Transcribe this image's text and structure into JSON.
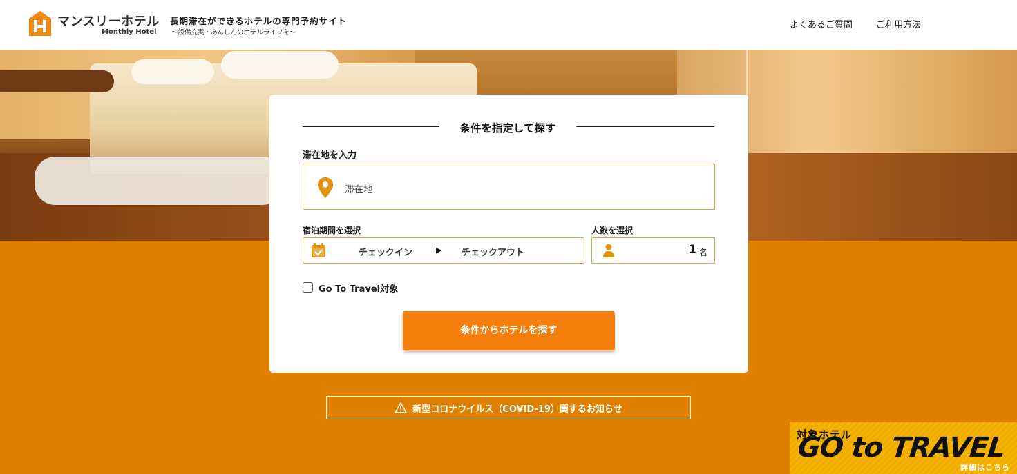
{
  "header": {
    "logo_name": "マンスリーホテル",
    "logo_sub": "Monthly Hotel",
    "tagline": "長期滞在ができるホテルの専門予約サイト",
    "tagline_sub": "〜設備充実・あんしんのホテルライフを〜",
    "nav": {
      "faq": "よくあるご質問",
      "howto": "ご利用方法"
    }
  },
  "search": {
    "title": "条件を指定して探す",
    "area_label": "滞在地を入力",
    "area_placeholder": "滞在地",
    "date_label": "宿泊期間を選択",
    "checkin": "チェックイン",
    "arrow": "▶",
    "checkout": "チェックアウト",
    "people_label": "人数を選択",
    "people_count": "1",
    "people_unit": "名",
    "goto_label": "Go To Travel対象",
    "goto_checked": false,
    "submit_label": "条件からホテルを探す"
  },
  "notice": {
    "covid": "新型コロナウイルス（COVID-19）関するお知らせ"
  },
  "banner": {
    "label": "対象ホテル",
    "logo": "GO to TRAVEL",
    "more": "詳細はこちら"
  },
  "colors": {
    "accent": "#f57f0c",
    "background": "#e08000",
    "border": "#d8a24a",
    "banner": "#f5b400"
  },
  "icons": {
    "logo": "logo-h-icon",
    "location": "map-pin-icon",
    "calendar": "calendar-check-icon",
    "person": "person-icon",
    "warning": "warning-triangle-icon"
  }
}
